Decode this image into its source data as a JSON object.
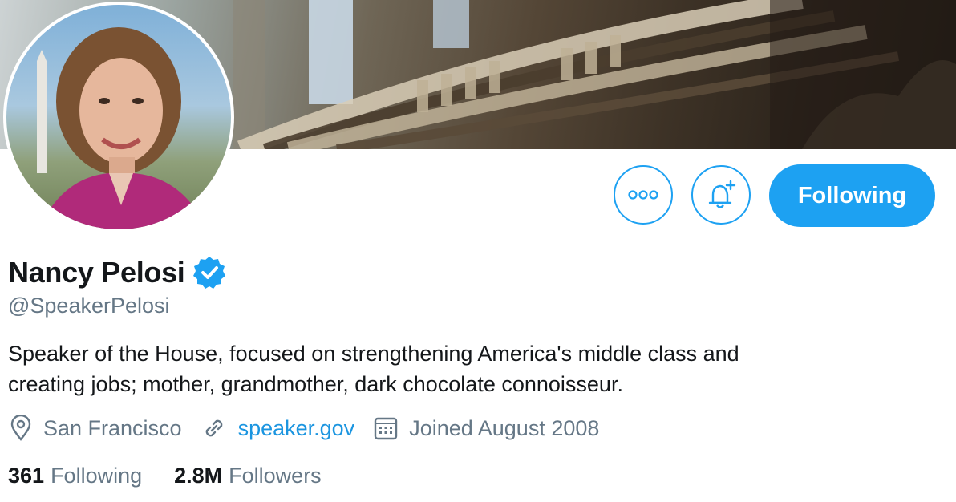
{
  "profile": {
    "name": "Nancy Pelosi",
    "handle": "@SpeakerPelosi",
    "bio_line1": "Speaker of the House, focused on strengthening America's middle class and",
    "bio_line2": "creating jobs; mother, grandmother, dark chocolate connoisseur.",
    "location": "San Francisco",
    "website": "speaker.gov",
    "joined": "Joined August 2008"
  },
  "actions": {
    "more_icon": "more-icon",
    "notify_icon": "bell-plus-icon",
    "follow_label": "Following"
  },
  "stats": {
    "following_count": "361",
    "following_label": "Following",
    "followers_count": "2.8M",
    "followers_label": "Followers"
  },
  "colors": {
    "accent": "#1da1f2",
    "link": "#1b95e0",
    "secondary_text": "#657786",
    "primary_text": "#14171a"
  }
}
